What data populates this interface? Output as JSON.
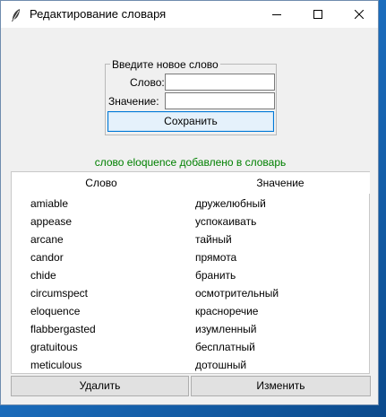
{
  "window": {
    "title": "Редактирование словаря",
    "app_icon": "feather-icon"
  },
  "form": {
    "legend": "Введите новое слово",
    "word_label": "Слово:",
    "meaning_label": "Значение:",
    "word_value": "",
    "meaning_value": "",
    "save_label": "Сохранить"
  },
  "status": {
    "text": "слово eloquence добавлено в словарь",
    "color": "#008000"
  },
  "table": {
    "columns": [
      "Слово",
      "Значение"
    ],
    "rows": [
      {
        "word": "amiable",
        "meaning": "дружелюбный"
      },
      {
        "word": "appease",
        "meaning": "успокаивать"
      },
      {
        "word": "arcane",
        "meaning": "тайный"
      },
      {
        "word": "candor",
        "meaning": "прямота"
      },
      {
        "word": "chide",
        "meaning": "бранить"
      },
      {
        "word": "circumspect",
        "meaning": "осмотрительный"
      },
      {
        "word": "eloquence",
        "meaning": "красноречие"
      },
      {
        "word": "flabbergasted",
        "meaning": "изумленный"
      },
      {
        "word": "gratuitous",
        "meaning": "бесплатный"
      },
      {
        "word": "meticulous",
        "meaning": "дотошный"
      }
    ]
  },
  "actions": {
    "delete_label": "Удалить",
    "edit_label": "Изменить"
  }
}
